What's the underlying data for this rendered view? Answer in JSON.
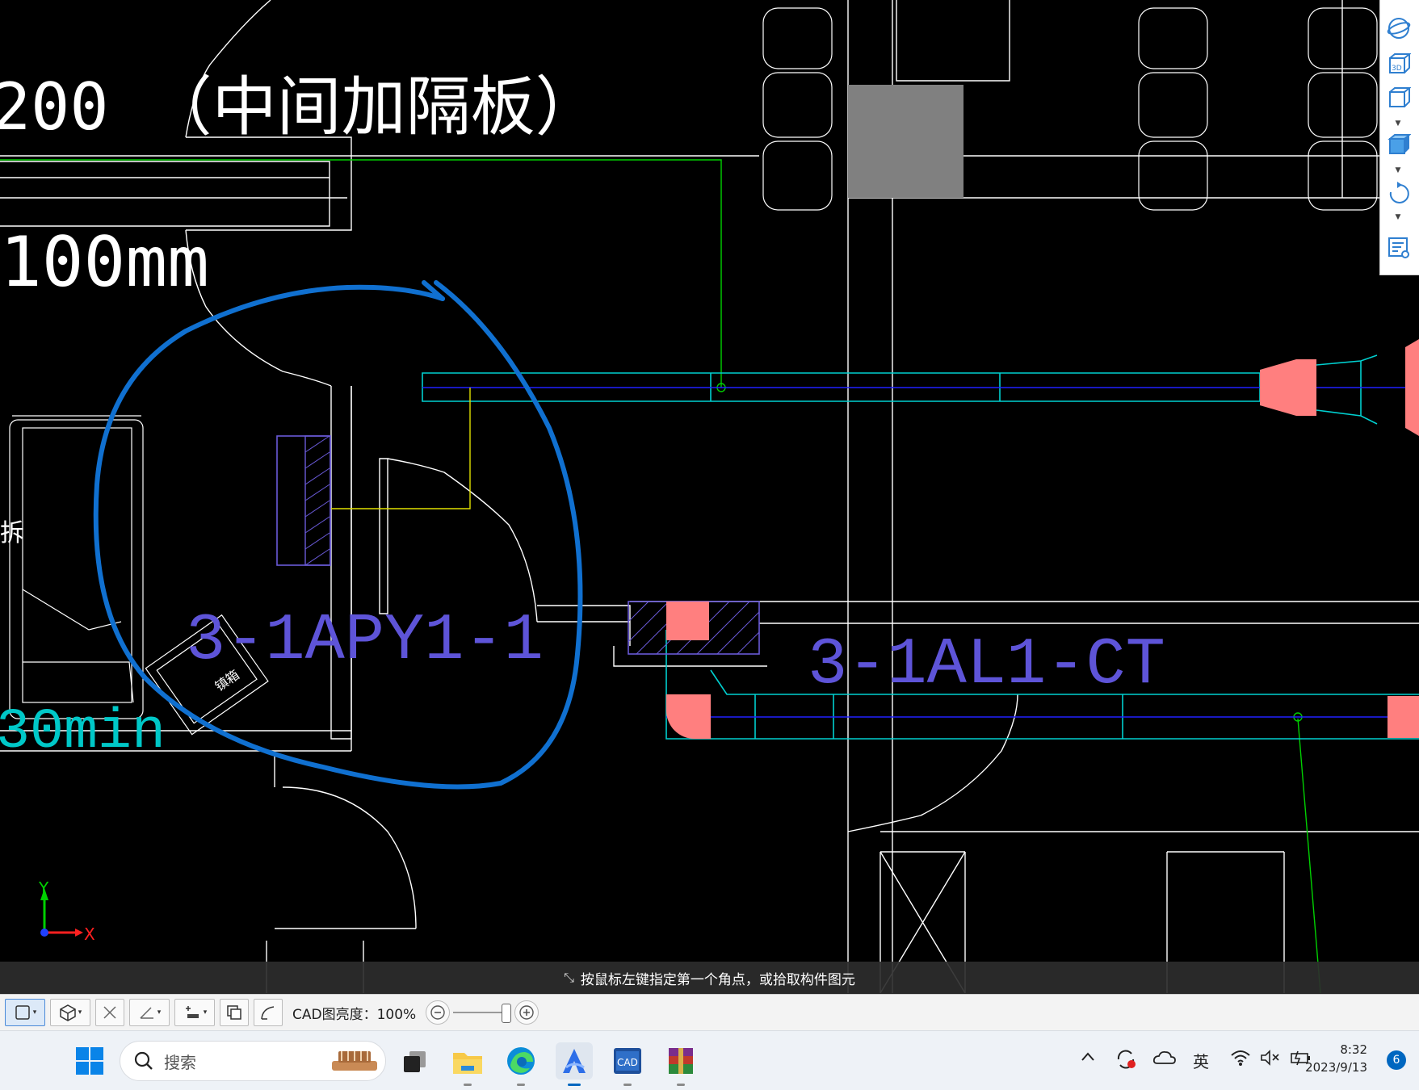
{
  "drawing": {
    "label_partition": "200 （中间加隔板）",
    "label_width": "100mm",
    "label_cabinet_a": "3-1APY1-1",
    "label_cabinet_b": "3-1AL1-CT",
    "label_time": "30min",
    "label_small": "拆",
    "label_box": "镇箱"
  },
  "axis": {
    "y": "Y",
    "x": "X"
  },
  "side_toolbar": {
    "items": [
      "orbit-icon",
      "3d-view-icon",
      "cube-view-icon",
      "solid-cube-icon",
      "rotate-icon",
      "layer-panel-icon"
    ],
    "badge_3d": "3D"
  },
  "prompt": {
    "text": "按鼠标左键指定第一个角点，或拾取构件图元"
  },
  "bottom_toolbar": {
    "brightness_label": "CAD图亮度：100%",
    "slider_value": 1.0
  },
  "taskbar": {
    "search_placeholder": "搜索",
    "apps": [
      "file-explorer-icon",
      "edge-icon",
      "glodon-icon",
      "cad-icon",
      "winrar-icon"
    ],
    "cad_app_text": "CAD",
    "tray": {
      "ime": "英",
      "time": "8:32",
      "date": "2023/9/13",
      "notifications": "6"
    }
  },
  "colors": {
    "cad_background": "#000000",
    "cyan": "#00d0d0",
    "green": "#00e000",
    "yellow": "#e0e000",
    "purple": "#6a5ad8",
    "pink": "#ff7f7f",
    "annotation_blue": "#1070d0",
    "accent": "#0067c0"
  }
}
